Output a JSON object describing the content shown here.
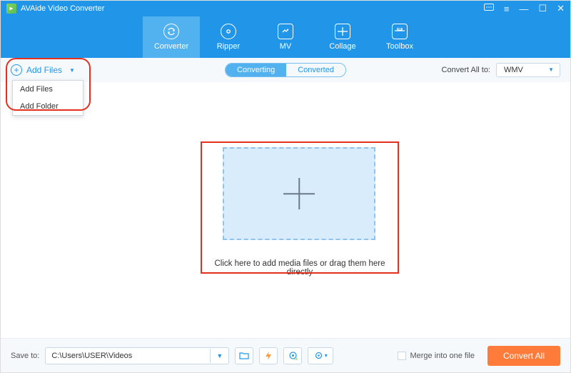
{
  "titlebar": {
    "title": "AVAide Video Converter"
  },
  "nav": {
    "items": [
      {
        "label": "Converter"
      },
      {
        "label": "Ripper"
      },
      {
        "label": "MV"
      },
      {
        "label": "Collage"
      },
      {
        "label": "Toolbox"
      }
    ]
  },
  "toolbar": {
    "add_label": "Add Files",
    "tab_converting": "Converting",
    "tab_converted": "Converted",
    "convert_all_label": "Convert All to:",
    "format": "WMV"
  },
  "dropdown": {
    "items": [
      {
        "label": "Add Files"
      },
      {
        "label": "Add Folder"
      }
    ]
  },
  "dropzone": {
    "hint": "Click here to add media files or drag them here directly"
  },
  "bottom": {
    "save_label": "Save to:",
    "path": "C:\\Users\\USER\\Videos",
    "merge_label": "Merge into one file",
    "convert_label": "Convert All"
  }
}
